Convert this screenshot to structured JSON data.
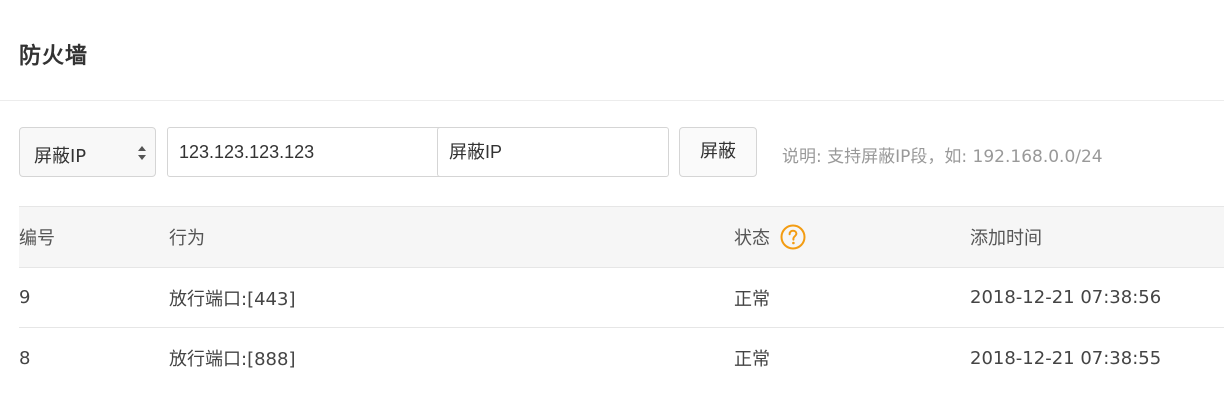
{
  "page": {
    "title": "防火墙"
  },
  "toolbar": {
    "select_value": "屏蔽IP",
    "ip_value": "123.123.123.123",
    "note_value": "屏蔽IP",
    "block_button": "屏蔽",
    "hint": "说明: 支持屏蔽IP段，如: 192.168.0.0/24"
  },
  "table": {
    "headers": [
      "编号",
      "行为",
      "状态",
      "添加时间"
    ],
    "status_help_icon": "question-circle-icon",
    "rows": [
      {
        "id": "9",
        "action": "放行端口:[443]",
        "status": "正常",
        "time": "2018-12-21 07:38:56"
      },
      {
        "id": "8",
        "action": "放行端口:[888]",
        "status": "正常",
        "time": "2018-12-21 07:38:55"
      }
    ]
  },
  "colors": {
    "accent": "#f39c12",
    "border": "#d5d5d5",
    "header_bg": "#f6f6f6"
  }
}
